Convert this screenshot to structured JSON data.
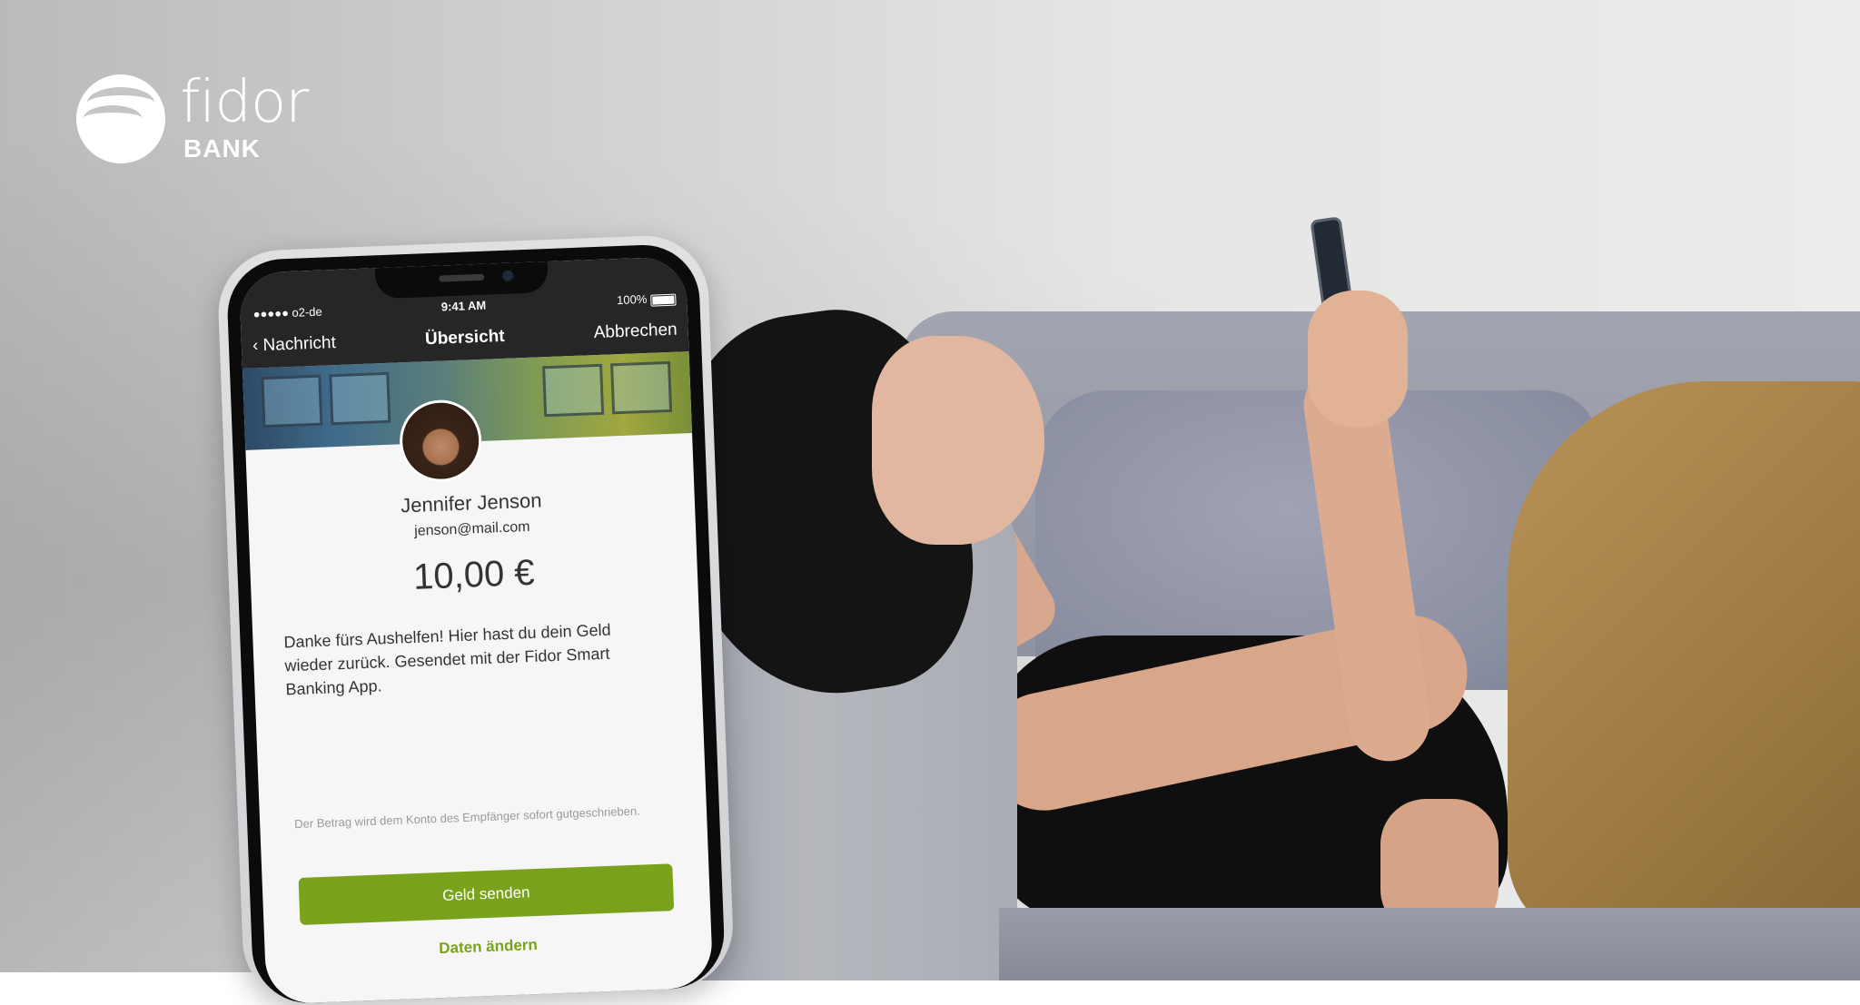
{
  "brand": {
    "logo_word": "fidor",
    "logo_sub": "BANK"
  },
  "phone": {
    "status": {
      "carrier": "●●●●● o2-de",
      "time": "9:41 AM",
      "battery": "100%"
    },
    "nav": {
      "back_label": "Nachricht",
      "title": "Übersicht",
      "cancel_label": "Abbrechen"
    },
    "recipient": {
      "name": "Jennifer Jenson",
      "email": "jenson@mail.com"
    },
    "amount": "10,00 €",
    "message": "Danke fürs Aushelfen! Hier hast du dein Geld wieder zurück. Gesendet mit der Fidor Smart Banking App.",
    "hint": "Der Betrag wird dem Konto des Empfänger sofort gutgeschrieben.",
    "primary_button": "Geld senden",
    "secondary_link": "Daten ändern"
  },
  "colors": {
    "accent_green": "#7ba21d",
    "topbar": "#262626"
  },
  "icons": [
    "chevron-left-icon",
    "wifi-icon",
    "battery-icon",
    "fidor-logo-icon"
  ]
}
